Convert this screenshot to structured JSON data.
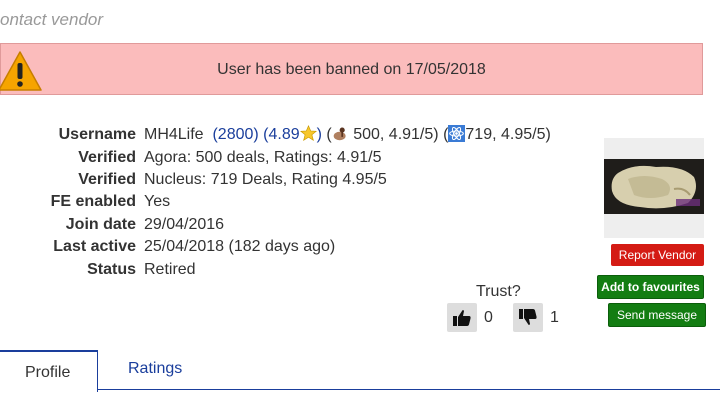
{
  "page": {
    "title": "ontact vendor"
  },
  "ban": {
    "text": "User has been banned on 17/05/2018"
  },
  "profile": {
    "username_label": "Username",
    "username": "MH4Life",
    "feedback_count": "(2800)",
    "rating_open": "(4.89",
    "rating_close": ")",
    "agora_stats_open": "(",
    "agora_stats": "500, 4.91/5)",
    "nucleus_stats_open": "(",
    "nucleus_stats": "719, 4.95/5)",
    "verified_label": "Verified",
    "verified_agora": "Agora: 500 deals, Ratings: 4.91/5",
    "verified_label_2": "Verified",
    "verified_nucleus": "Nucleus: 719 Deals, Rating 4.95/5",
    "fe_label": "FE enabled",
    "fe_value": "Yes",
    "join_label": "Join date",
    "join_value": "29/04/2016",
    "last_active_label": "Last active",
    "last_active_value": "25/04/2018 (182 days ago)",
    "status_label": "Status",
    "status_value": "Retired"
  },
  "actions": {
    "report": "Report Vendor",
    "favourite": "Add to favourites",
    "message": "Send message"
  },
  "trust": {
    "label": "Trust?",
    "up_count": "0",
    "down_count": "1"
  },
  "tabs": [
    {
      "label": "Profile",
      "active": true
    },
    {
      "label": "Ratings",
      "active": false
    }
  ],
  "icons": {
    "warning": "warning-icon",
    "star": "star-icon",
    "agora": "agora-icon",
    "nucleus": "nucleus-icon",
    "thumbs_up": "thumbs-up-icon",
    "thumbs_down": "thumbs-down-icon"
  },
  "colors": {
    "banner_bg": "#fbbcbc",
    "link": "#1a3e9c",
    "report_button": "#d41b14",
    "green_button": "#137d12"
  }
}
